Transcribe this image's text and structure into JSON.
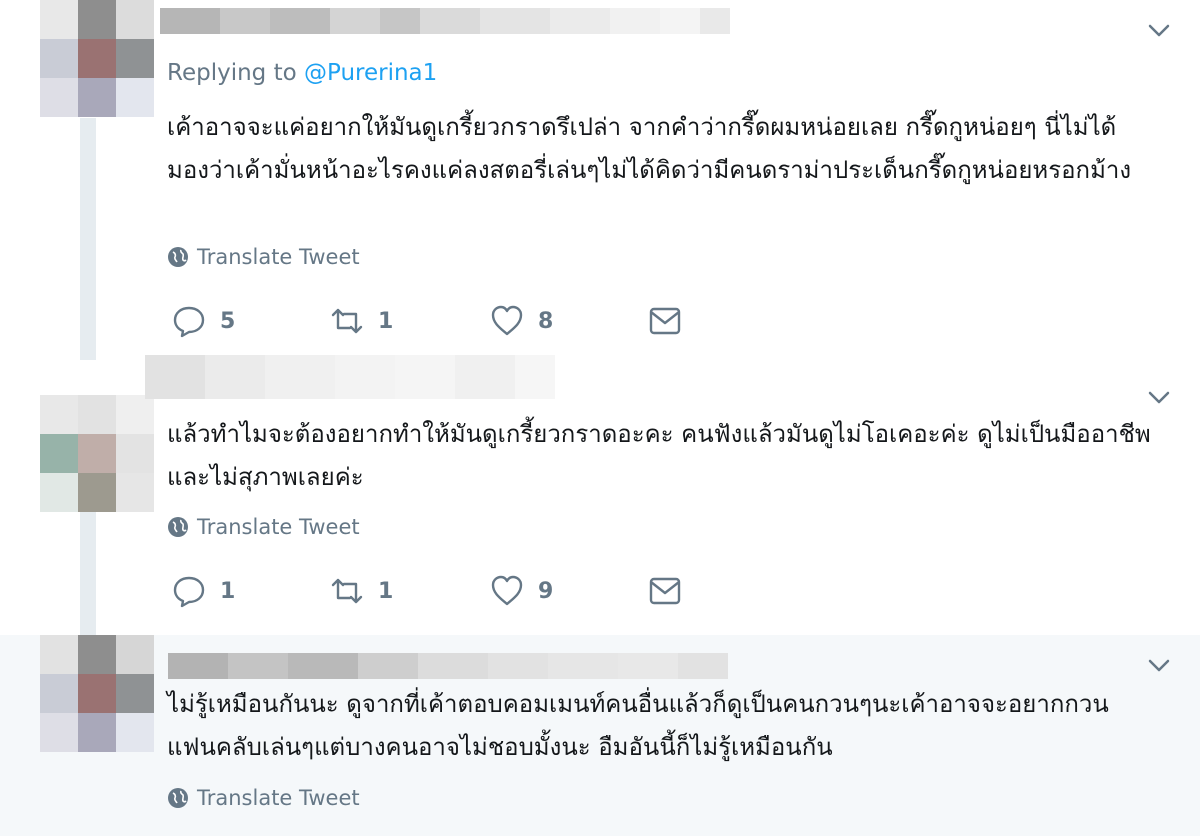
{
  "tweets": [
    {
      "replying_prefix": "Replying to",
      "replying_handle": "@Purerina1",
      "text": "เค้าอาจจะแค่อยากให้มันดูเกรี้ยวกราดรึเปล่า จากคำว่ากรี๊ดผมหน่อยเลย กรี๊ดกูหน่อยๆ นี่ไม่ได้มองว่าเค้ามั่นหน้าอะไรคงแค่ลงสตอรี่เล่นๆไม่ได้คิดว่ามีคนดราม่าประเด็นกรี๊ดกูหน่อยหรอกม้าง",
      "translate_label": "Translate Tweet",
      "replies": "5",
      "retweets": "1",
      "likes": "8"
    },
    {
      "text": "แล้วทำไมจะต้องอยากทำให้มันดูเกรี้ยวกราดอะคะ คนฟังแล้วมันดูไม่โอเคอะค่ะ ดูไม่เป็นมืออาชีพและไม่สุภาพเลยค่ะ",
      "translate_label": "Translate Tweet",
      "replies": "1",
      "retweets": "1",
      "likes": "9"
    },
    {
      "text": "ไม่รู้เหมือนกันนะ ดูจากที่เค้าตอบคอมเมนท์คนอื่นแล้วก็ดูเป็นคนกวนๆนะเค้าอาจจะอยากกวนแฟนคลับเล่นๆแต่บางคนอาจไม่ชอบมั้งนะ อืมอันนี้ก็ไม่รู้เหมือนกัน",
      "translate_label": "Translate Tweet"
    }
  ],
  "colors": {
    "text": "#14171a",
    "secondary": "#657786",
    "accent": "#1da1f2",
    "thread_line": "#e6ecf0",
    "hover_bg": "#f5f8fa"
  },
  "icons": [
    "chevron-down-icon",
    "globe-icon",
    "reply-icon",
    "retweet-icon",
    "like-icon",
    "message-icon"
  ]
}
